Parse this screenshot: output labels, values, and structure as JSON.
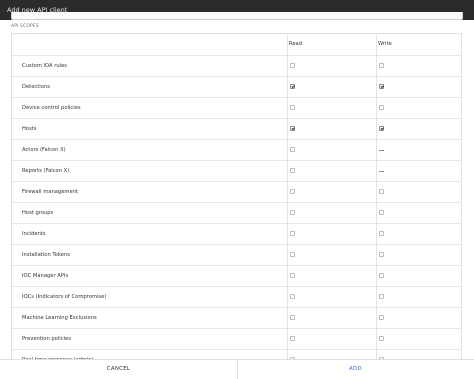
{
  "window": {
    "title": "Add new API client"
  },
  "scopes": {
    "section_label": "API SCOPES",
    "col_read": "Read",
    "col_write": "Write",
    "rows": [
      {
        "name": "Custom IOA rules",
        "read": "unchecked",
        "write": "unchecked"
      },
      {
        "name": "Detections",
        "read": "checked",
        "write": "checked"
      },
      {
        "name": "Device control policies",
        "read": "unchecked",
        "write": "unchecked"
      },
      {
        "name": "Hosts",
        "read": "checked",
        "write": "checked"
      },
      {
        "name": "Actors (Falcon X)",
        "read": "unchecked",
        "write": "none"
      },
      {
        "name": "Reports (Falcon X)",
        "read": "unchecked",
        "write": "none"
      },
      {
        "name": "Firewall management",
        "read": "unchecked",
        "write": "unchecked"
      },
      {
        "name": "Host groups",
        "read": "unchecked",
        "write": "unchecked"
      },
      {
        "name": "Incidents",
        "read": "unchecked",
        "write": "unchecked"
      },
      {
        "name": "Installation Tokens",
        "read": "unchecked",
        "write": "unchecked"
      },
      {
        "name": "IOC Manager APIs",
        "read": "unchecked",
        "write": "unchecked"
      },
      {
        "name": "IOCs (Indicators of Compromise)",
        "read": "unchecked",
        "write": "unchecked"
      },
      {
        "name": "Machine Learning Exclusions",
        "read": "unchecked",
        "write": "unchecked"
      },
      {
        "name": "Prevention policies",
        "read": "unchecked",
        "write": "unchecked"
      },
      {
        "name": "Real time response (admin)",
        "read": "unchecked",
        "write": "unchecked"
      }
    ]
  },
  "footer": {
    "cancel_label": "CANCEL",
    "add_label": "ADD"
  }
}
